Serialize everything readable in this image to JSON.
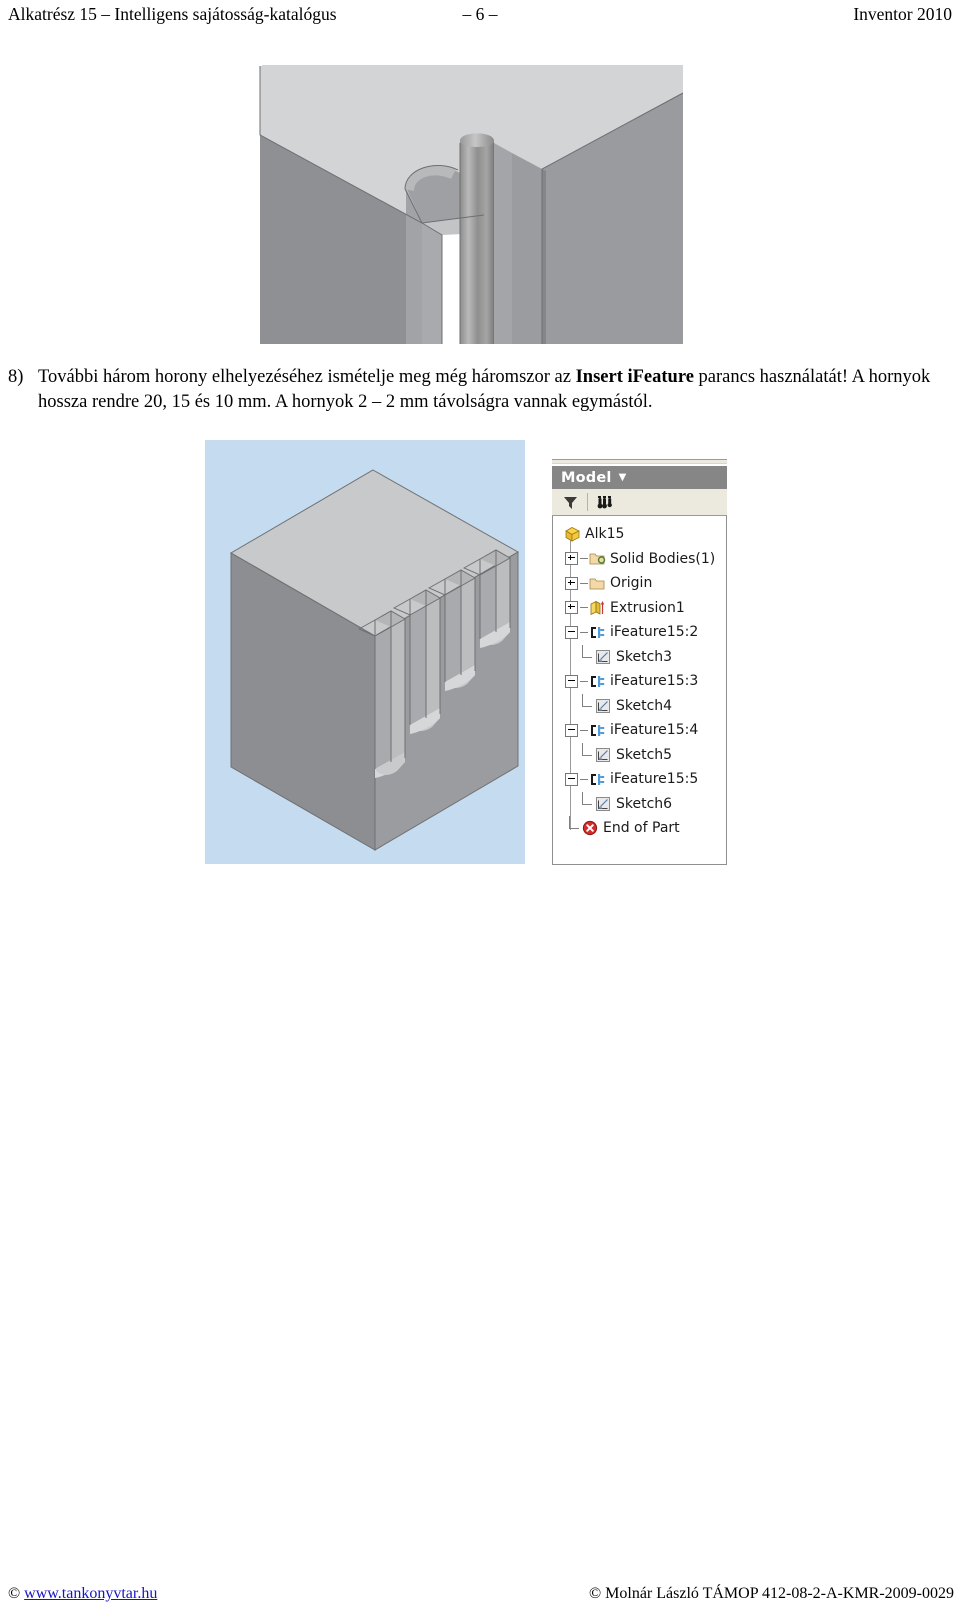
{
  "header": {
    "left": "Alkatrész 15 – Intelligens sajátosság-katalógus",
    "page_marker": "– 6 –",
    "right": "Inventor 2010"
  },
  "instruction": {
    "marker": "8)",
    "line1_part1": "További három horony elhelyezéséhez ismételje meg még háromszor az ",
    "line1_bold": "Insert iFeature",
    "line1_part2": " parancs használatát!",
    "line2": "A hornyok hossza rendre 20, 15 és 10 mm. A hornyok 2 – 2 mm távolságra vannak egymástól."
  },
  "figures": {
    "detail_render": "groove-corner-closeup-render",
    "part_render": "slotted-block-isometric-render",
    "part_background_color": "#c5dcf0"
  },
  "browser": {
    "title": "Model",
    "caret": "▼",
    "toolbar": [
      {
        "name": "filter-icon",
        "label": "Filter"
      },
      {
        "name": "find-icon",
        "label": "Find"
      }
    ],
    "tree": [
      {
        "label": "Alk15",
        "level": 0,
        "expander": "none",
        "icon": "part-cube-icon"
      },
      {
        "label": "Solid Bodies(1)",
        "level": 1,
        "expander": "plus",
        "icon": "solid-bodies-folder-icon"
      },
      {
        "label": "Origin",
        "level": 1,
        "expander": "plus",
        "icon": "origin-folder-icon"
      },
      {
        "label": "Extrusion1",
        "level": 1,
        "expander": "plus",
        "icon": "extrusion-icon"
      },
      {
        "label": "iFeature15:2",
        "level": 1,
        "expander": "minus",
        "icon": "ifeature-icon"
      },
      {
        "label": "Sketch3",
        "level": 2,
        "expander": "none",
        "icon": "sketch-icon"
      },
      {
        "label": "iFeature15:3",
        "level": 1,
        "expander": "minus",
        "icon": "ifeature-icon"
      },
      {
        "label": "Sketch4",
        "level": 2,
        "expander": "none",
        "icon": "sketch-icon"
      },
      {
        "label": "iFeature15:4",
        "level": 1,
        "expander": "minus",
        "icon": "ifeature-icon"
      },
      {
        "label": "Sketch5",
        "level": 2,
        "expander": "none",
        "icon": "sketch-icon"
      },
      {
        "label": "iFeature15:5",
        "level": 1,
        "expander": "minus",
        "icon": "ifeature-icon"
      },
      {
        "label": "Sketch6",
        "level": 2,
        "expander": "none",
        "icon": "sketch-icon"
      },
      {
        "label": "End of Part",
        "level": 1,
        "expander": "none",
        "icon": "end-of-part-icon"
      }
    ]
  },
  "footer": {
    "copyright_symbol": "©",
    "link_text": "www.tankonyvtar.hu",
    "right": "© Molnár László TÁMOP 412-08-2-A-KMR-2009-0029"
  }
}
